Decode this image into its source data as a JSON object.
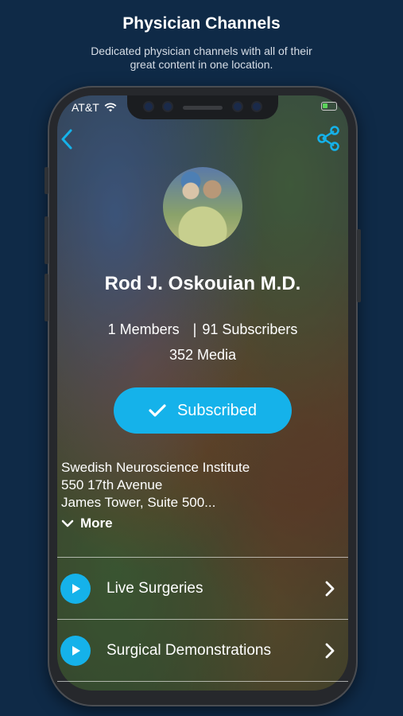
{
  "promo": {
    "title": "Physician Channels",
    "subtitle": "Dedicated physician channels with all of their great content in one location."
  },
  "status_bar": {
    "carrier": "AT&T",
    "icons": [
      "wifi-icon",
      "battery-icon"
    ],
    "battery_color": "#5bd35b"
  },
  "nav": {
    "back_icon": "chevron-left-icon",
    "share_icon": "share-icon",
    "accent": "#15b2ea"
  },
  "channel": {
    "name": "Rod J. Oskouian M.D.",
    "members": "1 Members",
    "separator": "|",
    "subscribers": "91 Subscribers",
    "media": "352 Media",
    "subscribe_label": "Subscribed",
    "address_lines": [
      "Swedish Neuroscience Institute",
      "550 17th Avenue",
      "James Tower, Suite 500..."
    ],
    "more_label": "More"
  },
  "menu": [
    {
      "label": "Live Surgeries",
      "icon": "play-icon"
    },
    {
      "label": "Surgical Demonstrations",
      "icon": "play-icon"
    }
  ]
}
